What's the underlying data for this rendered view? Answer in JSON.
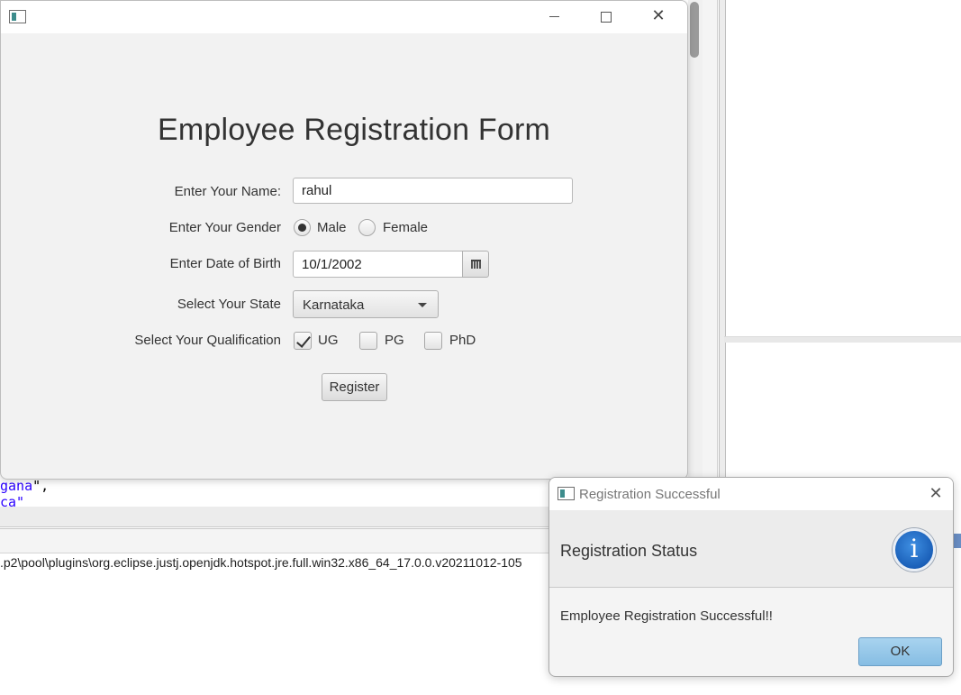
{
  "ide": {
    "code_line_1": "gana",
    "code_line_1_suffix": "\",",
    "code_line_2": "ca\"",
    "console_path": ".p2\\pool\\plugins\\org.eclipse.justj.openjdk.hotspot.jre.full.win32.x86_64_17.0.0.v20211012-105"
  },
  "form_window": {
    "controls": {
      "minimize_icon": "minimize-icon",
      "maximize_icon": "maximize-icon",
      "close_icon": "close-icon",
      "close_glyph": "✕"
    },
    "title": "Employee Registration Form",
    "name_label": "Enter Your Name:",
    "name_value": "rahul",
    "gender_label": "Enter Your Gender",
    "gender_options": {
      "male": "Male",
      "female": "Female"
    },
    "gender_selected": "Male",
    "dob_label": "Enter Date of Birth",
    "dob_value": "10/1/2002",
    "state_label": "Select Your State",
    "state_value": "Karnataka",
    "qualification_label": "Select Your Qualification",
    "qualifications": {
      "ug": "UG",
      "pg": "PG",
      "phd": "PhD"
    },
    "qualification_checked": [
      "UG"
    ],
    "register_label": "Register"
  },
  "dialog": {
    "title": "Registration Successful",
    "close_glyph": "✕",
    "header": "Registration Status",
    "info_glyph": "i",
    "content": "Employee Registration Successful!!",
    "ok_label": "OK"
  },
  "colors": {
    "window_bg": "#f2f2f2",
    "ok_button": "#94c8ea",
    "info_icon": "#1f6cc4"
  }
}
